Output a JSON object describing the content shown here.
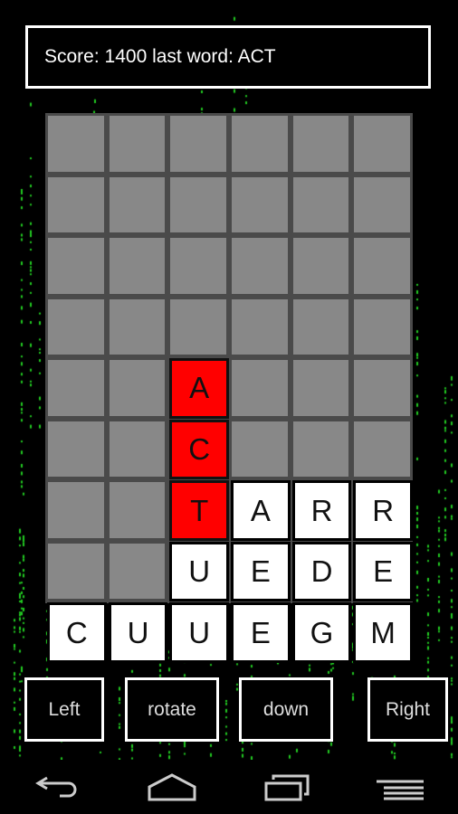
{
  "score_bar": {
    "text": "Score: 1400 last word: ACT"
  },
  "board": {
    "rows": [
      [
        "",
        "",
        "",
        "",
        "",
        ""
      ],
      [
        "",
        "",
        "",
        "",
        "",
        ""
      ],
      [
        "",
        "",
        "",
        "",
        "",
        ""
      ],
      [
        "",
        "",
        "",
        "",
        "",
        ""
      ],
      [
        "",
        "",
        "A",
        "",
        "",
        ""
      ],
      [
        "",
        "",
        "C",
        "",
        "",
        ""
      ],
      [
        "",
        "",
        "T",
        "A",
        "R",
        "R"
      ],
      [
        "",
        "",
        "U",
        "E",
        "D",
        "E"
      ],
      [
        "C",
        "U",
        "U",
        "E",
        "G",
        "M"
      ]
    ],
    "highlighted": [
      [
        4,
        2
      ],
      [
        5,
        2
      ],
      [
        6,
        2
      ]
    ],
    "colors": {
      "empty": "#888888",
      "tile": "#ffffff",
      "highlight": "#ff0000",
      "rain": "#22cc22"
    }
  },
  "controls": {
    "left": "Left",
    "rotate": "rotate",
    "down": "down",
    "right": "Right"
  },
  "navbar": {
    "icons": [
      "back-icon",
      "home-icon",
      "recent-apps-icon",
      "menu-icon"
    ]
  }
}
